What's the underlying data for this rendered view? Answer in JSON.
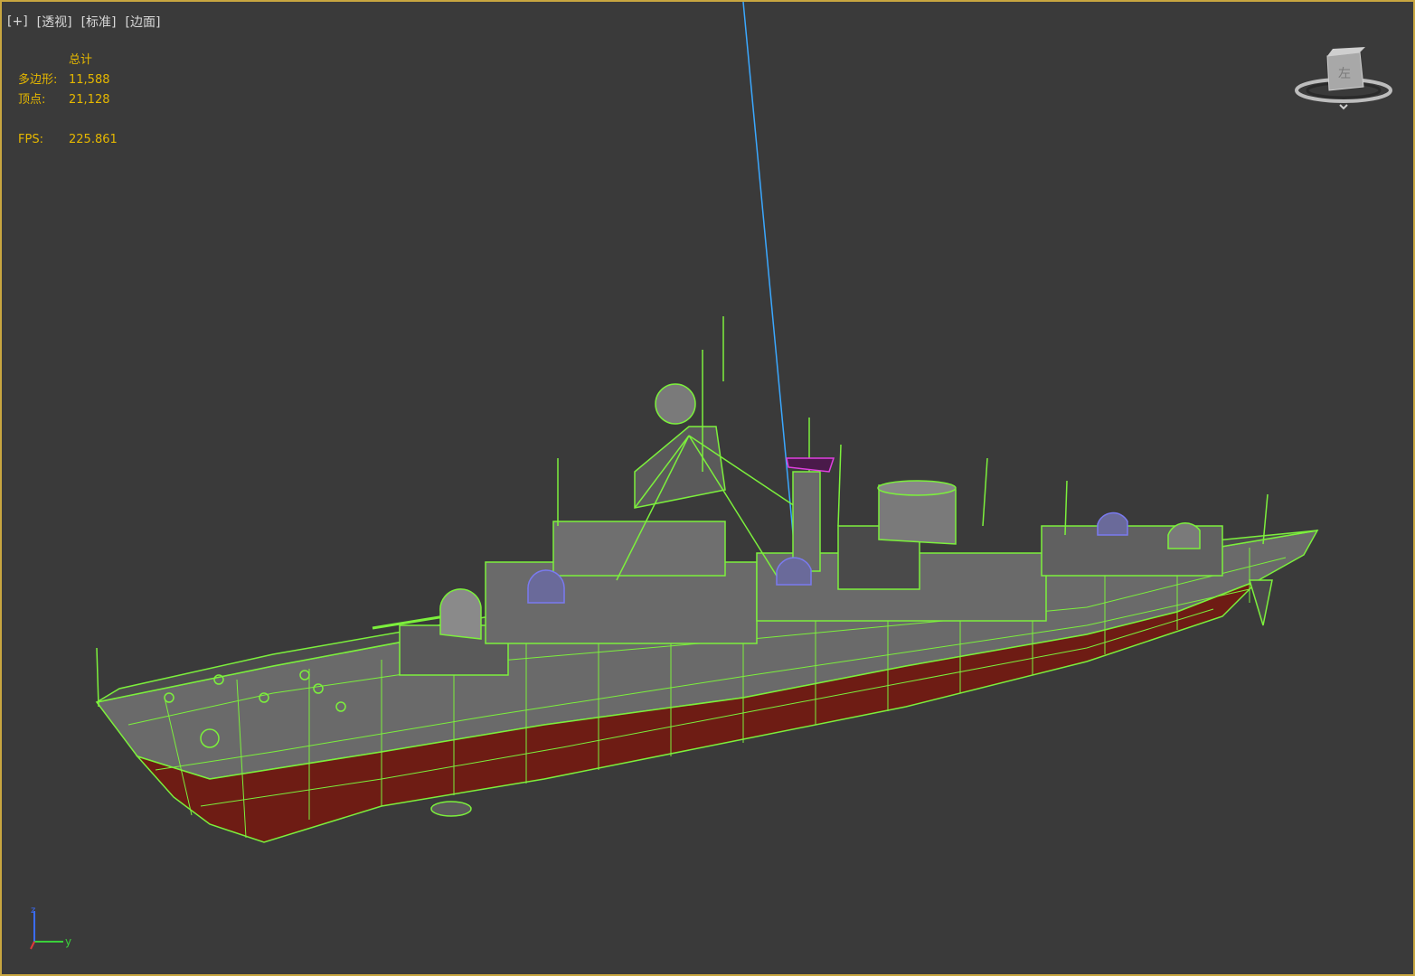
{
  "viewport": {
    "menu": {
      "plus": "[+]",
      "view": "[透视]",
      "shading": "[标准]",
      "edges": "[边面]"
    },
    "stats": {
      "header": "总计",
      "polys_label": "多边形:",
      "polys_value": "11,588",
      "verts_label": "顶点:",
      "verts_value": "21,128",
      "fps_label": "FPS:",
      "fps_value": "225.861"
    },
    "axis": {
      "z": "z",
      "y": "y"
    },
    "colors": {
      "border": "#c8a640",
      "background": "#3a3a3a",
      "stats_text": "#e6b800",
      "wireframe": "#7cf03c",
      "hull_grey": "#6e6e6e",
      "hull_red": "#7a1f16"
    }
  }
}
